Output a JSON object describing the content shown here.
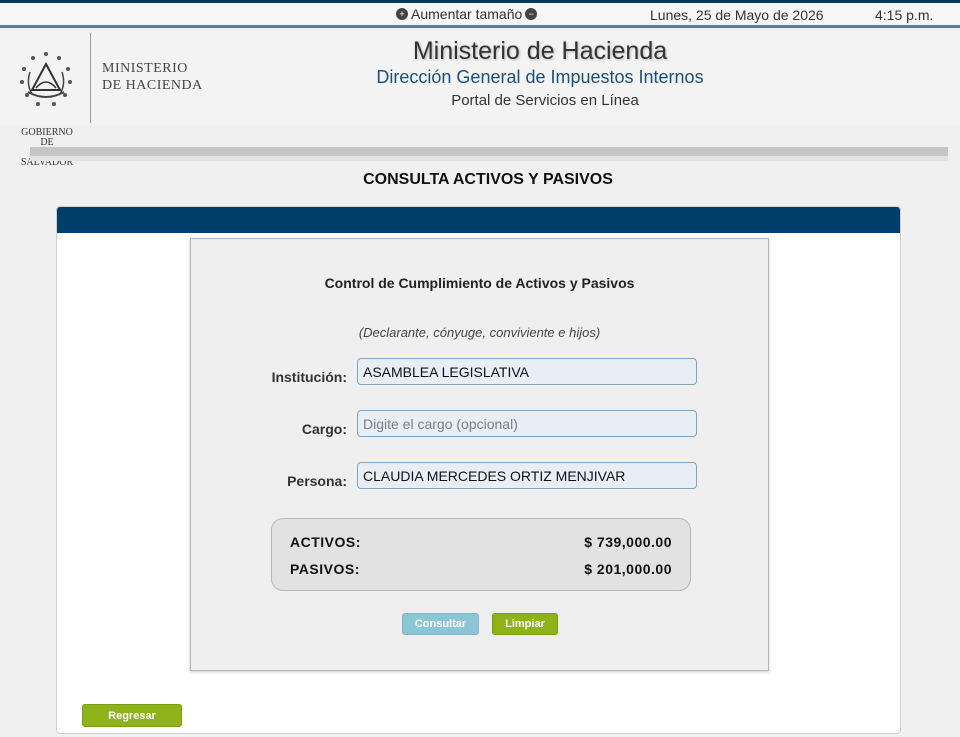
{
  "topbar": {
    "zoom_label": "Aumentar tamaño",
    "date": "Lunes, 25 de Mayo de 2026",
    "time": "4:15 p.m."
  },
  "header": {
    "seal_text": [
      "GOBIERNO DE",
      "EL SALVADOR"
    ],
    "logo_text": [
      "MINISTERIO",
      "DE HACIENDA"
    ],
    "title": "Ministerio de Hacienda",
    "subtitle": "Dirección General de Impuestos Internos",
    "portal": "Portal de Servicios en Línea"
  },
  "page": {
    "title": "CONSULTA ACTIVOS Y PASIVOS"
  },
  "form": {
    "title": "Control de Cumplimiento de Activos y Pasivos",
    "note": "(Declarante, cónyuge, conviviente e hijos)",
    "institucion": {
      "label": "Institución:",
      "value": "ASAMBLEA LEGISLATIVA"
    },
    "cargo": {
      "label": "Cargo:",
      "value": "",
      "placeholder": "Digite el cargo (opcional)"
    },
    "persona": {
      "label": "Persona:",
      "value": "CLAUDIA MERCEDES ORTIZ MENJIVAR"
    },
    "summary": {
      "activos_label": "ACTIVOS:",
      "activos_value": "$ 739,000.00",
      "pasivos_label": "PASIVOS:",
      "pasivos_value": "$ 201,000.00"
    },
    "buttons": {
      "consultar": "Consultar",
      "limpiar": "Limpiar"
    }
  },
  "footer": {
    "regresar": "Regresar"
  },
  "colors": {
    "primary_navy": "#003f6b",
    "green_button": "#8db21a",
    "light_blue_button": "#8cc6d6",
    "subtitle_blue": "#1d4f7a"
  },
  "icons": {
    "zoom_left": "globe-plus-icon",
    "zoom_right": "globe-minus-icon",
    "seal": "national-seal-icon"
  }
}
